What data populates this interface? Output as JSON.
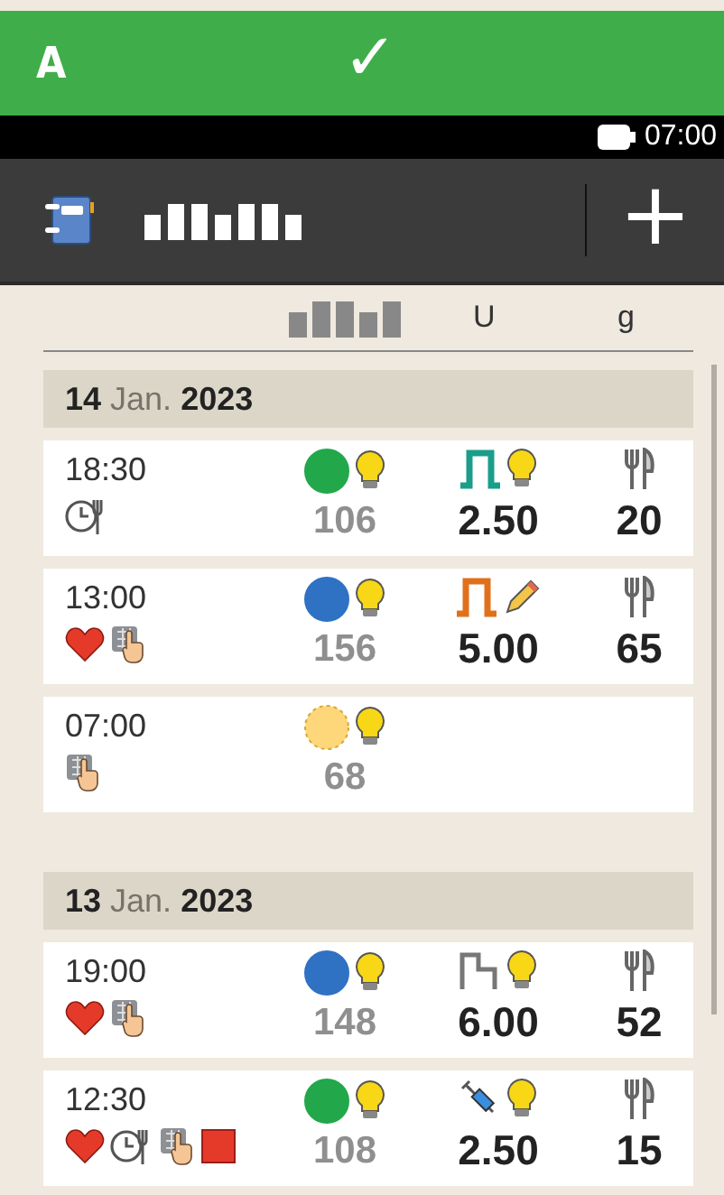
{
  "top_bar": {
    "label": "A",
    "check": "✓"
  },
  "status_bar": {
    "time": "07:00"
  },
  "toolbar": {
    "add": "+"
  },
  "columns": {
    "insulin": "U",
    "carbs": "g"
  },
  "days": [
    {
      "day": "14",
      "month": "Jan.",
      "year": "2023",
      "entries": [
        {
          "time": "18:30",
          "marks": [
            {
              "kind": "meal-time"
            }
          ],
          "dot": {
            "color": "#22a84a",
            "dashed": false
          },
          "glucose": "106",
          "insulin": {
            "kind": "pulse",
            "color": "#1a9e8a",
            "note": {
              "kind": "bulb"
            },
            "value": "2.50"
          },
          "carbs": "20"
        },
        {
          "time": "13:00",
          "marks": [
            {
              "kind": "heart"
            },
            {
              "kind": "keypad"
            }
          ],
          "dot": {
            "color": "#2f72c4",
            "dashed": false
          },
          "glucose": "156",
          "insulin": {
            "kind": "pulse",
            "color": "#e0701c",
            "note": {
              "kind": "pencil"
            },
            "value": "5.00"
          },
          "carbs": "65"
        },
        {
          "time": "07:00",
          "marks": [
            {
              "kind": "keypad"
            }
          ],
          "dot": {
            "color": "#fdd77a",
            "dashed": true
          },
          "glucose": "68"
        }
      ]
    },
    {
      "day": "13",
      "month": "Jan.",
      "year": "2023",
      "entries": [
        {
          "time": "19:00",
          "marks": [
            {
              "kind": "heart"
            },
            {
              "kind": "keypad"
            }
          ],
          "dot": {
            "color": "#2f72c4",
            "dashed": false
          },
          "glucose": "148",
          "insulin": {
            "kind": "step",
            "note": {
              "kind": "bulb"
            },
            "value": "6.00"
          },
          "carbs": "52"
        },
        {
          "time": "12:30",
          "marks": [
            {
              "kind": "heart"
            },
            {
              "kind": "meal-time"
            },
            {
              "kind": "keypad"
            },
            {
              "kind": "stop"
            }
          ],
          "dot": {
            "color": "#22a84a",
            "dashed": false
          },
          "glucose": "108",
          "insulin": {
            "kind": "syringe",
            "note": {
              "kind": "bulb"
            },
            "value": "2.50"
          },
          "carbs": "15"
        }
      ]
    }
  ]
}
